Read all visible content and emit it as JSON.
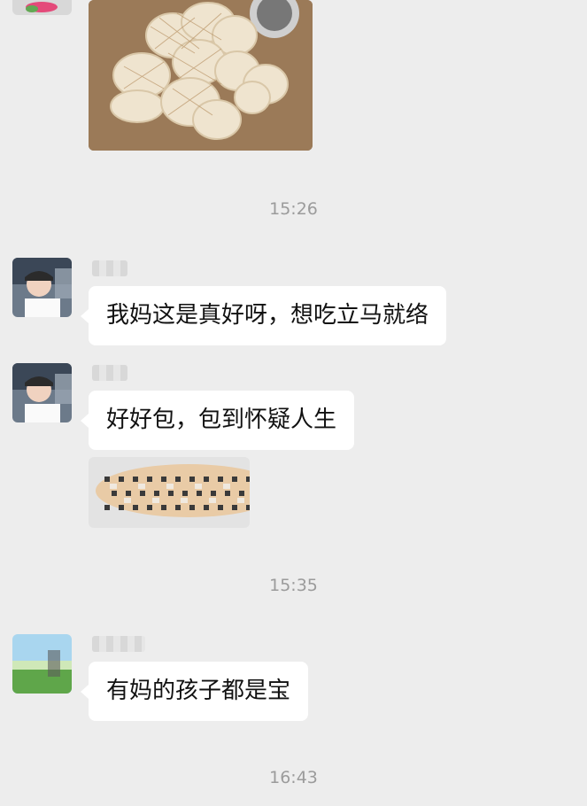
{
  "timestamps": {
    "t1": "15:26",
    "t2": "15:35",
    "t3": "16:43"
  },
  "messages": [
    {
      "text": "我妈这是真好呀，想吃立马就络"
    },
    {
      "text": "好好包，包到怀疑人生"
    },
    {
      "text": "有妈的孩子都是宝"
    }
  ],
  "colors": {
    "background": "#ededed",
    "bubble": "#ffffff",
    "timestamp": "#9b9b9b"
  }
}
